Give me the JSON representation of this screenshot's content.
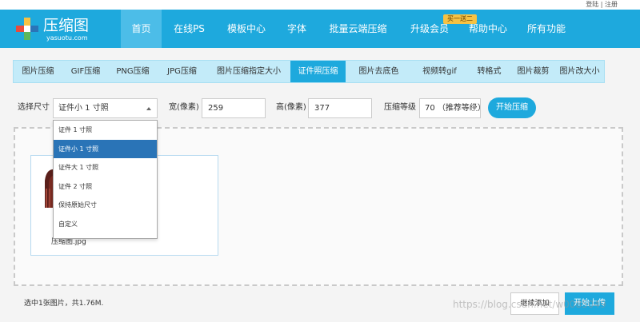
{
  "topbar": {
    "login": "登陆",
    "separator": "|",
    "register": "注册"
  },
  "logo": {
    "title": "压缩图",
    "subtitle": "yasuotu.com"
  },
  "nav": {
    "items": [
      "首页",
      "在线PS",
      "模板中心",
      "字体",
      "批量云端压缩",
      "升级会员",
      "帮助中心",
      "所有功能"
    ],
    "badge": "买一送二"
  },
  "tabs": [
    "图片压缩",
    "GIF压缩",
    "PNG压缩",
    "JPG压缩",
    "图片压缩指定大小",
    "证件照压缩",
    "图片去底色",
    "视频转gif",
    "转格式",
    "图片裁剪",
    "图片改大小"
  ],
  "controls": {
    "size_label": "选择尺寸",
    "size_value": "证件小 1 寸照",
    "width_label": "宽(像素)",
    "width_value": "259",
    "height_label": "高(像素)",
    "height_value": "377",
    "level_label": "压缩等级",
    "level_value": "70 （推荐等级）",
    "start_label": "开始压缩"
  },
  "dropdown_options": [
    "证件 1 寸照",
    "证件小 1 寸照",
    "证件大 1 寸照",
    "证件 2 寸照",
    "保持原始尺寸",
    "自定义"
  ],
  "file": {
    "name": "压缩图.jpg"
  },
  "footer": {
    "status": "选中1张图片，共1.76M.",
    "continue_label": "继续添加",
    "upload_label": "开始上传"
  },
  "watermark": "https://blog.csdn.net/w0085049",
  "colors": {
    "brand": "#1ea9dd",
    "tab_bg": "#c3ebf9",
    "selected_option": "#2a74b7",
    "badge": "#f6c243"
  }
}
